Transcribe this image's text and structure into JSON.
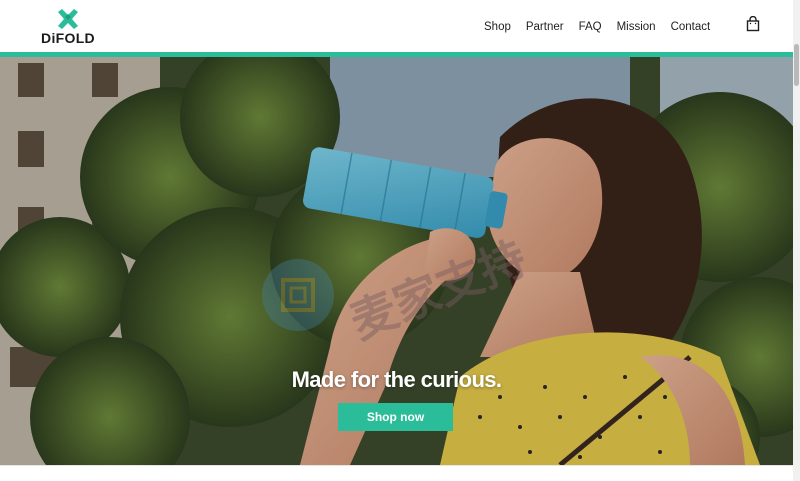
{
  "brand": {
    "name": "DiFOLD",
    "logo_icon": "difold-x-logo",
    "accent_color": "#2bbd9a"
  },
  "nav": {
    "items": [
      {
        "label": "Shop"
      },
      {
        "label": "Partner"
      },
      {
        "label": "FAQ"
      },
      {
        "label": "Mission"
      },
      {
        "label": "Contact"
      }
    ],
    "cart_icon": "shopping-bag-icon"
  },
  "hero": {
    "headline": "Made for the curious.",
    "cta_label": "Shop now",
    "cta_color": "#2bbd9a",
    "watermark_text": "麦家支持"
  }
}
